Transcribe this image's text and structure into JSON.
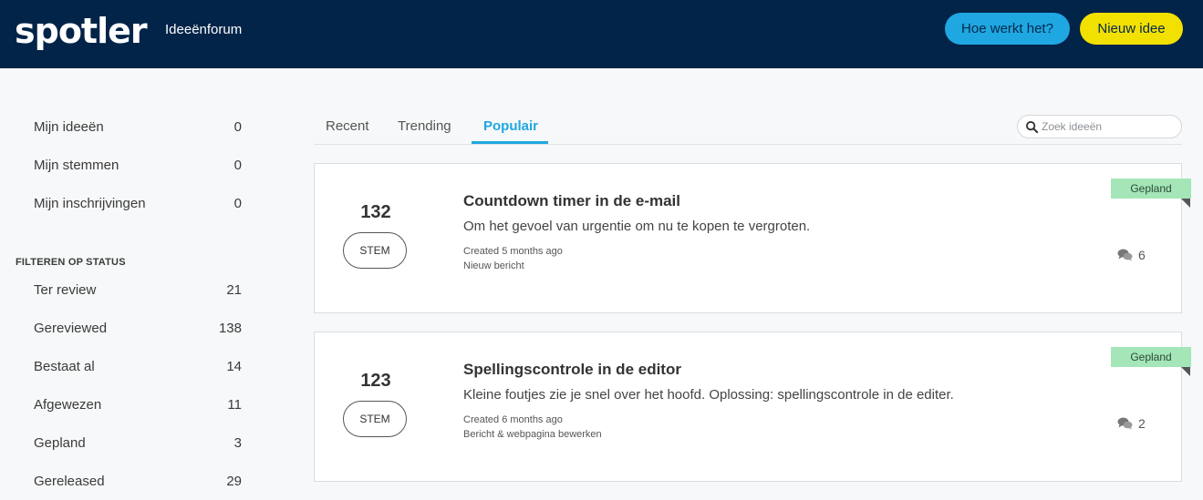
{
  "header": {
    "logo": "spotler",
    "forum_title": "Ideeënforum",
    "help_button": "Hoe werkt het?",
    "new_idea_button": "Nieuw idee"
  },
  "sidebar": {
    "mine": [
      {
        "label": "Mijn ideeën",
        "count": "0"
      },
      {
        "label": "Mijn stemmen",
        "count": "0"
      },
      {
        "label": "Mijn inschrijvingen",
        "count": "0"
      }
    ],
    "status_heading": "FILTEREN OP STATUS",
    "statuses": [
      {
        "label": "Ter review",
        "count": "21"
      },
      {
        "label": "Gereviewed",
        "count": "138"
      },
      {
        "label": "Bestaat al",
        "count": "14"
      },
      {
        "label": "Afgewezen",
        "count": "11"
      },
      {
        "label": "Gepland",
        "count": "3"
      },
      {
        "label": "Gereleased",
        "count": "29"
      }
    ]
  },
  "tabs": [
    {
      "label": "Recent"
    },
    {
      "label": "Trending"
    },
    {
      "label": "Populair",
      "active": true
    }
  ],
  "search": {
    "placeholder": "Zoek ideeën"
  },
  "ideas": [
    {
      "votes": "132",
      "vote_label": "STEM",
      "title": "Countdown timer in de e-mail",
      "description": "Om het gevoel van urgentie om nu te kopen te vergroten.",
      "created": "Created 5 months ago",
      "category": "Nieuw bericht",
      "status": "Gepland",
      "comments": "6"
    },
    {
      "votes": "123",
      "vote_label": "STEM",
      "title": "Spellingscontrole in de editor",
      "description": "Kleine foutjes zie je snel over het hoofd. Oplossing: spellingscontrole in de editer.",
      "created": "Created 6 months ago",
      "category": "Bericht & webpagina bewerken",
      "status": "Gepland",
      "comments": "2"
    }
  ],
  "colors": {
    "header_bg": "#022448",
    "accent_blue": "#1fa7e1",
    "accent_yellow": "#f2e000",
    "status_green": "#a4e6b8"
  }
}
